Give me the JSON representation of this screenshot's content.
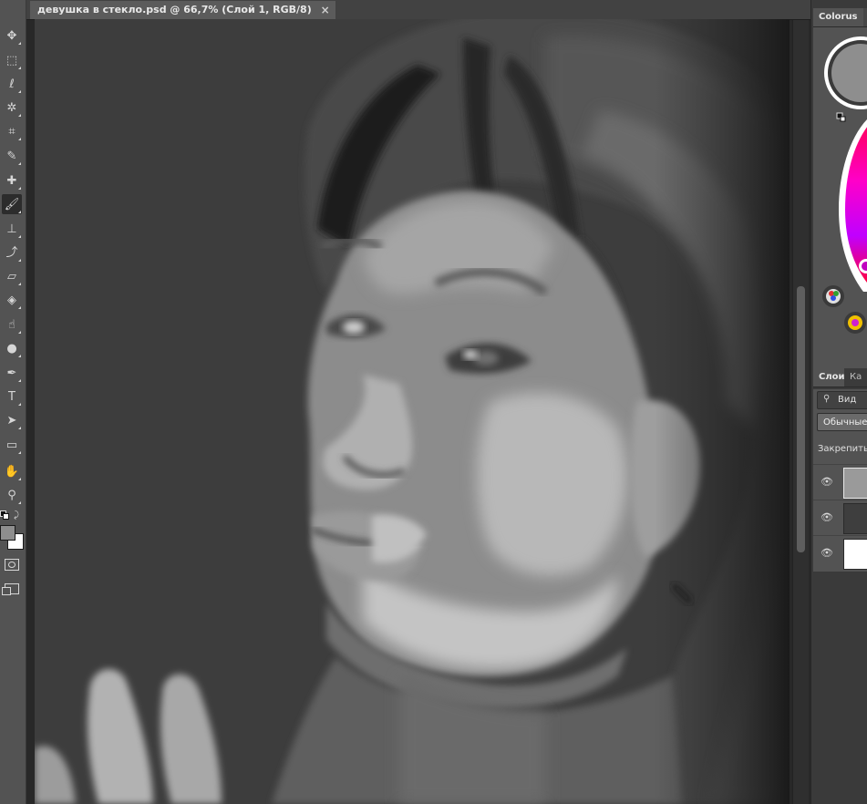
{
  "document": {
    "tab_title": "девушка в стекло.psd @ 66,7% (Слой 1, RGB/8)",
    "close_glyph": "×"
  },
  "tools": [
    {
      "name": "move-tool",
      "icon": "move-icon",
      "glyph": "✥"
    },
    {
      "name": "marquee-tool",
      "icon": "marquee-icon",
      "glyph": "⬚"
    },
    {
      "name": "lasso-tool",
      "icon": "lasso-icon",
      "glyph": "ℓ"
    },
    {
      "name": "magic-wand-tool",
      "icon": "magic-wand-icon",
      "glyph": "✲"
    },
    {
      "name": "crop-tool",
      "icon": "crop-icon",
      "glyph": "⌗"
    },
    {
      "name": "eyedropper-tool",
      "icon": "eyedropper-icon",
      "glyph": "✎"
    },
    {
      "name": "healing-brush-tool",
      "icon": "bandage-icon",
      "glyph": "✚"
    },
    {
      "name": "brush-tool",
      "icon": "brush-icon",
      "glyph": "🖌",
      "active": true
    },
    {
      "name": "stamp-tool",
      "icon": "stamp-icon",
      "glyph": "⊥"
    },
    {
      "name": "history-brush-tool",
      "icon": "history-brush-icon",
      "glyph": "⤴"
    },
    {
      "name": "eraser-tool",
      "icon": "eraser-icon",
      "glyph": "▱"
    },
    {
      "name": "paint-bucket-tool",
      "icon": "paint-bucket-icon",
      "glyph": "◈"
    },
    {
      "name": "smudge-tool",
      "icon": "smudge-icon",
      "glyph": "☝"
    },
    {
      "name": "dodge-tool",
      "icon": "dodge-icon",
      "glyph": "●"
    },
    {
      "name": "pen-tool",
      "icon": "pen-icon",
      "glyph": "✒"
    },
    {
      "name": "type-tool",
      "icon": "type-icon",
      "glyph": "T"
    },
    {
      "name": "path-selection-tool",
      "icon": "path-selection-icon",
      "glyph": "➤"
    },
    {
      "name": "rectangle-tool",
      "icon": "rectangle-icon",
      "glyph": "▭"
    },
    {
      "name": "hand-tool",
      "icon": "hand-icon",
      "glyph": "✋"
    },
    {
      "name": "zoom-tool",
      "icon": "zoom-icon",
      "glyph": "⚲"
    }
  ],
  "colors": {
    "foreground": "#8e8e8e",
    "background": "#ffffff",
    "panel_bg": "#535353",
    "toolbar_bg": "#535353",
    "canvas_bg": "#3c3c3c"
  },
  "colorus_panel": {
    "tab_label": "Colorus",
    "preview_color": "#8e8e8e"
  },
  "layers_panel": {
    "tabs": [
      "Слои",
      "Ка"
    ],
    "search_label": "Вид",
    "blend_mode": "Обычные",
    "lock_label": "Закрепить:",
    "layers": [
      {
        "name": "layer-1",
        "thumb": "#9a9a9a",
        "selected": true
      },
      {
        "name": "layer-2",
        "thumb": "#3e3e3e",
        "selected": false
      },
      {
        "name": "layer-3",
        "thumb": "#ffffff",
        "selected": false
      }
    ],
    "eye_glyph": "👁"
  }
}
